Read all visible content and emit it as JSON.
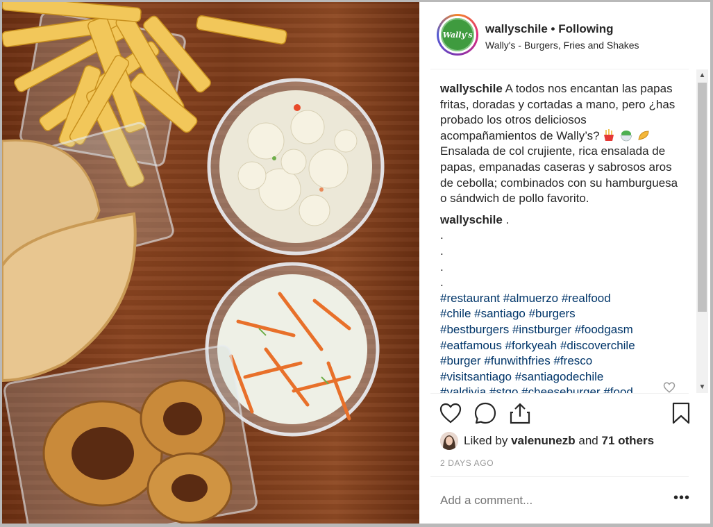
{
  "header": {
    "username": "wallyschile",
    "separator": "•",
    "follow_state": "Following",
    "location": "Wally's - Burgers, Fries and Shakes",
    "avatar_text": "Wally's"
  },
  "caption": {
    "author": "wallyschile",
    "text_part1": "A todos nos encantan las papas fritas, doradas y cortadas a mano, pero ¿has probado los otros deliciosos acompañamientos de Wally’s?",
    "emojis": [
      "fries-emoji",
      "salad-emoji",
      "taco-emoji"
    ],
    "text_part2": "Ensalada de col crujiente, rica ensalada de papas, empanadas caseras y sabrosos aros de cebolla; combinados con su hamburguesa o sándwich de pollo favorito."
  },
  "second_comment": {
    "author": "wallyschile",
    "text": ".",
    "dots": [
      ".",
      ".",
      ".",
      "."
    ],
    "hashtag_lines": [
      "#restaurant #almuerzo #realfood",
      "#chile #santiago #burgers",
      "#bestburgers #instburger #foodgasm",
      "#eatfamous #forkyeah #discoverchile",
      "#burger #funwithfries #fresco",
      "#visitsantiago #santiagodechile",
      "#valdivia #stgo #cheeseburger #food"
    ]
  },
  "likes": {
    "prefix": "Liked by",
    "user": "valenunezb",
    "conjunction": "and",
    "others": "71 others"
  },
  "timestamp": "2 DAYS AGO",
  "comment_input": {
    "placeholder": "Add a comment..."
  },
  "more_label": "•••",
  "icons": {
    "like": "heart-icon",
    "comment": "comment-icon",
    "share": "share-icon",
    "save": "bookmark-icon",
    "comment_like": "heart-icon",
    "scroll_up": "▲",
    "scroll_down": "▼"
  },
  "colors": {
    "text": "#262626",
    "hashtag": "#003569",
    "muted": "#999999",
    "placeholder": "#b5b5b5",
    "divider": "#efefef"
  }
}
